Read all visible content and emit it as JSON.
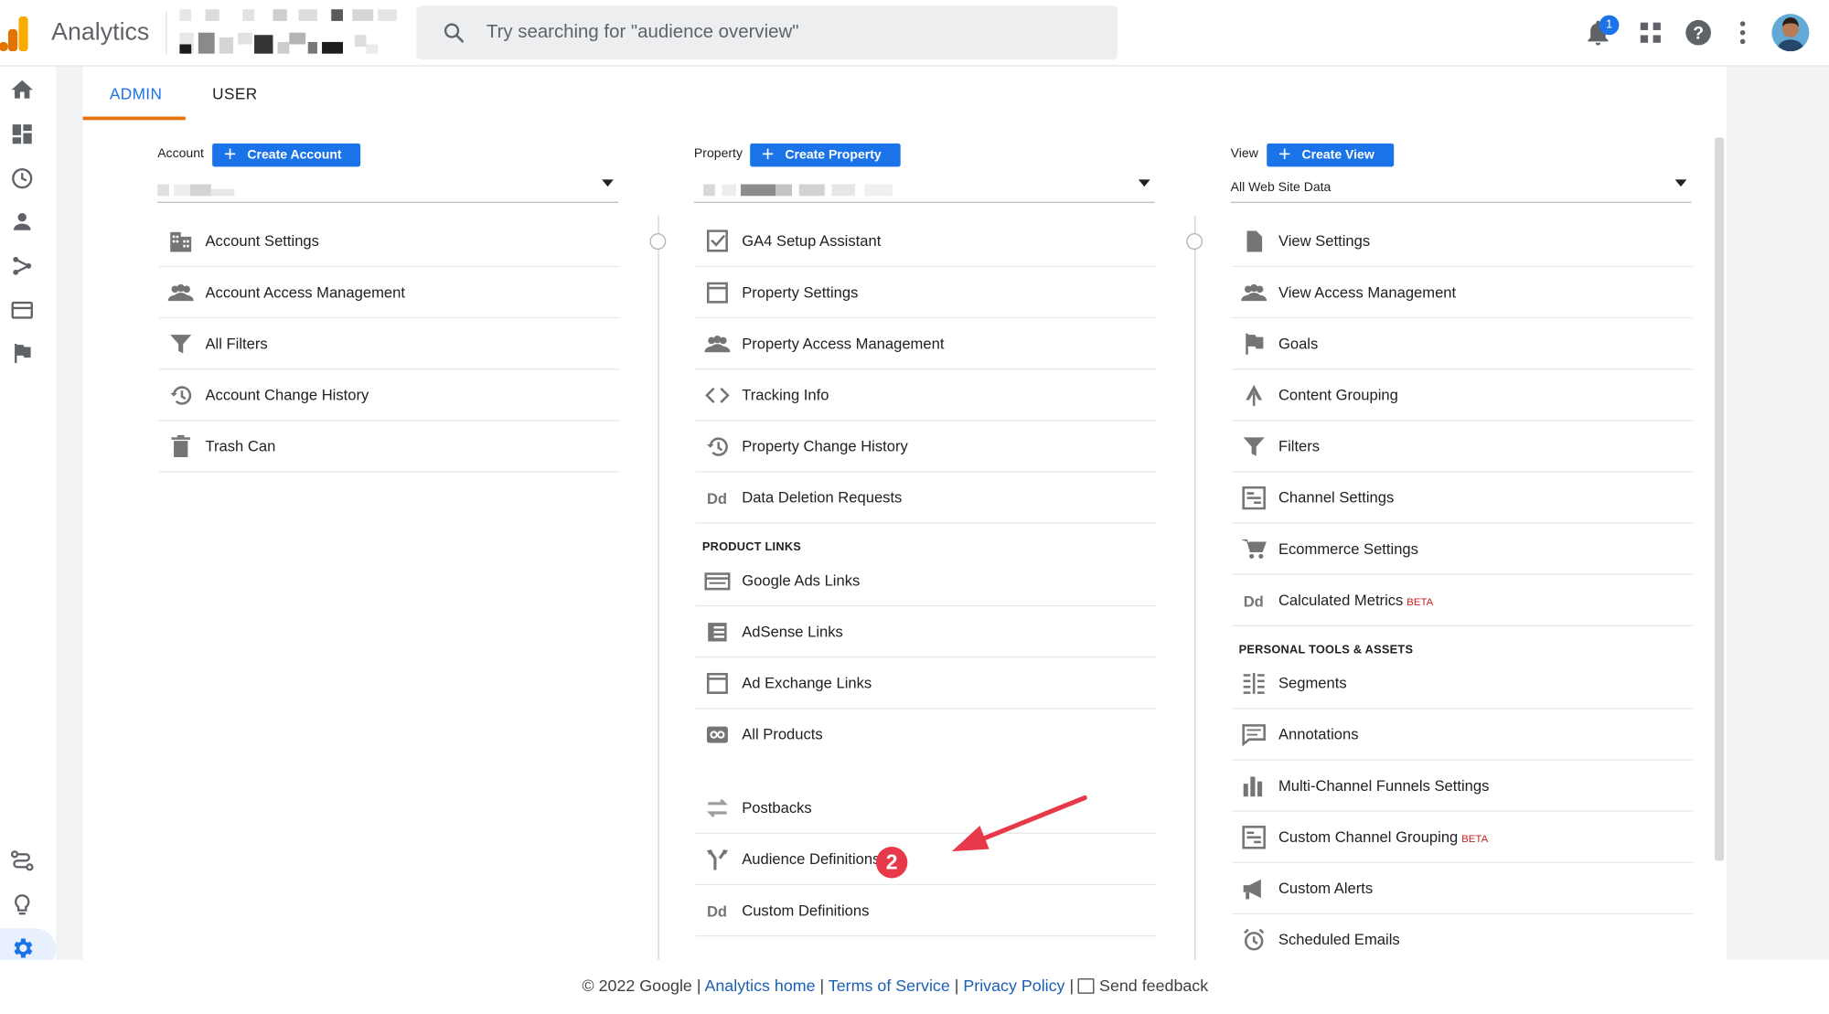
{
  "header": {
    "app_title": "Analytics",
    "search_placeholder": "Try searching for \"audience overview\"",
    "notification_count": "1"
  },
  "tabs": [
    {
      "label": "ADMIN",
      "active": true
    },
    {
      "label": "USER",
      "active": false
    }
  ],
  "account": {
    "label": "Account",
    "create_label": "Create Account",
    "items": [
      {
        "label": "Account Settings",
        "icon": "building-icon"
      },
      {
        "label": "Account Access Management",
        "icon": "people-icon"
      },
      {
        "label": "All Filters",
        "icon": "filter-icon"
      },
      {
        "label": "Account Change History",
        "icon": "history-icon"
      },
      {
        "label": "Trash Can",
        "icon": "trash-icon"
      }
    ]
  },
  "property": {
    "label": "Property",
    "create_label": "Create Property",
    "items": [
      {
        "label": "GA4 Setup Assistant",
        "icon": "checkbox-icon"
      },
      {
        "label": "Property Settings",
        "icon": "window-icon"
      },
      {
        "label": "Property Access Management",
        "icon": "people-icon"
      },
      {
        "label": "Tracking Info",
        "icon": "code-icon"
      },
      {
        "label": "Property Change History",
        "icon": "history-icon"
      },
      {
        "label": "Data Deletion Requests",
        "icon": "dd-icon"
      }
    ],
    "product_links_heading": "PRODUCT LINKS",
    "links": [
      {
        "label": "Google Ads Links",
        "icon": "ads-icon"
      },
      {
        "label": "AdSense Links",
        "icon": "adsense-icon"
      },
      {
        "label": "Ad Exchange Links",
        "icon": "window-icon"
      },
      {
        "label": "All Products",
        "icon": "link-icon"
      },
      {
        "label": "Postbacks",
        "icon": "postback-icon"
      },
      {
        "label": "Audience Definitions",
        "icon": "fork-icon"
      },
      {
        "label": "Custom Definitions",
        "icon": "dd-icon"
      }
    ]
  },
  "view": {
    "label": "View",
    "create_label": "Create View",
    "selected": "All Web Site Data",
    "items": [
      {
        "label": "View Settings",
        "icon": "doc-icon"
      },
      {
        "label": "View Access Management",
        "icon": "people-icon"
      },
      {
        "label": "Goals",
        "icon": "flag-icon"
      },
      {
        "label": "Content Grouping",
        "icon": "person-walk-icon"
      },
      {
        "label": "Filters",
        "icon": "filter-icon"
      },
      {
        "label": "Channel Settings",
        "icon": "channel-icon"
      },
      {
        "label": "Ecommerce Settings",
        "icon": "cart-icon"
      },
      {
        "label": "Calculated Metrics",
        "beta": "BETA",
        "icon": "dd-icon"
      }
    ],
    "personal_heading": "PERSONAL TOOLS & ASSETS",
    "personal": [
      {
        "label": "Segments",
        "icon": "segments-icon"
      },
      {
        "label": "Annotations",
        "icon": "comment-icon"
      },
      {
        "label": "Multi-Channel Funnels Settings",
        "icon": "bar-chart-icon"
      },
      {
        "label": "Custom Channel Grouping",
        "beta": "BETA",
        "icon": "channel-icon"
      },
      {
        "label": "Custom Alerts",
        "icon": "megaphone-icon"
      },
      {
        "label": "Scheduled Emails",
        "icon": "alarm-icon"
      }
    ]
  },
  "annotation_badge": "2",
  "footer": {
    "copyright": "© 2022 Google |",
    "analytics_home": "Analytics home",
    "sep1": "|",
    "terms": "Terms of Service",
    "sep2": "|",
    "privacy": "Privacy Policy",
    "sep3": "|",
    "feedback": "Send feedback"
  },
  "colors": {
    "accent": "#1a73e8",
    "tab_underline": "#e8710a",
    "annotation": "#e8394a"
  }
}
